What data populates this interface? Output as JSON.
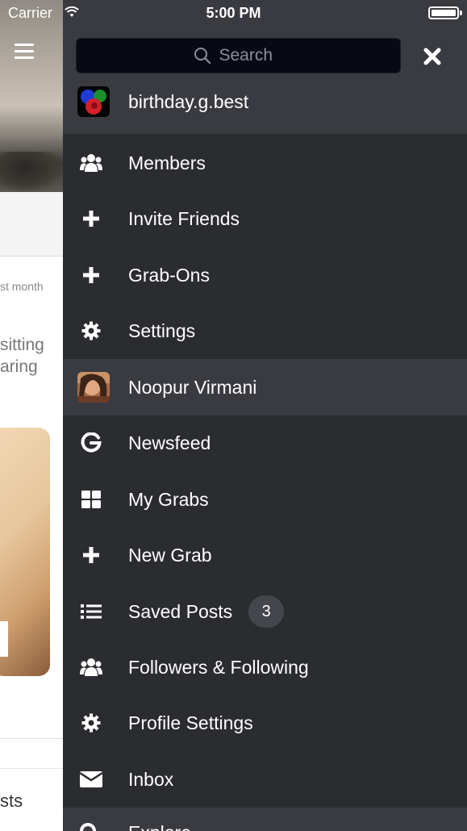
{
  "status_bar": {
    "carrier": "Carrier",
    "time": "5:00 PM"
  },
  "background_page": {
    "meta_text": "st month",
    "body_text_line1": "sitting",
    "body_text_line2": "aring",
    "footer_text": "sts"
  },
  "search": {
    "placeholder": "Search"
  },
  "group": {
    "name": "birthday.g.best",
    "items": [
      {
        "label": "Members",
        "icon": "users-icon"
      },
      {
        "label": "Invite Friends",
        "icon": "plus-icon"
      },
      {
        "label": "Grab-Ons",
        "icon": "plus-icon"
      },
      {
        "label": "Settings",
        "icon": "gear-icon"
      }
    ]
  },
  "user": {
    "name": "Noopur Virmani",
    "items": [
      {
        "label": "Newsfeed",
        "icon": "grab-logo-icon"
      },
      {
        "label": "My Grabs",
        "icon": "grid-icon"
      },
      {
        "label": "New Grab",
        "icon": "plus-icon"
      },
      {
        "label": "Saved Posts",
        "icon": "list-icon",
        "badge": "3"
      },
      {
        "label": "Followers & Following",
        "icon": "users-icon"
      },
      {
        "label": "Profile Settings",
        "icon": "gear-icon"
      },
      {
        "label": "Inbox",
        "icon": "envelope-icon"
      }
    ]
  },
  "bottom": {
    "label": "Explore"
  },
  "colors": {
    "drawer_bg": "#2b2c30",
    "highlight_bg": "#3a3b41",
    "search_bg": "#070913",
    "text": "#ffffff",
    "badge_bg": "#45464c"
  }
}
